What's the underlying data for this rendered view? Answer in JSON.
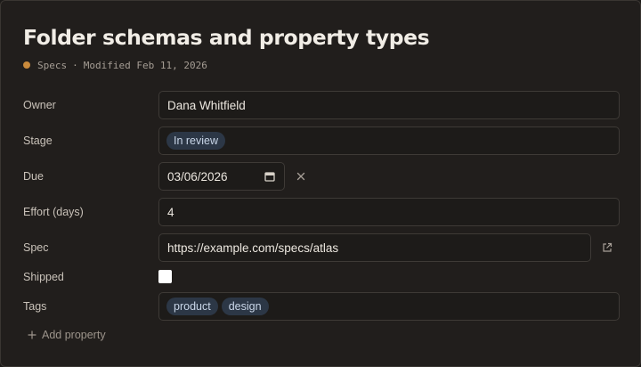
{
  "header": {
    "title": "Folder schemas and property types",
    "folder": "Specs",
    "folder_color": "#c98a3c",
    "separator": "·",
    "modified": "Modified Feb 11, 2026"
  },
  "properties": {
    "owner": {
      "label": "Owner",
      "value": "Dana Whitfield"
    },
    "stage": {
      "label": "Stage",
      "value": "In review"
    },
    "due": {
      "label": "Due",
      "value": "03/06/2026",
      "clear_icon": "close-icon",
      "picker_icon": "calendar-icon"
    },
    "effort": {
      "label": "Effort (days)",
      "value": "4"
    },
    "spec": {
      "label": "Spec",
      "value": "https://example.com/specs/atlas",
      "open_icon": "external-link-icon"
    },
    "shipped": {
      "label": "Shipped",
      "checked": false
    },
    "tags": {
      "label": "Tags",
      "values": [
        "product",
        "design"
      ]
    }
  },
  "actions": {
    "add_property": "Add property"
  },
  "colors": {
    "background": "#211e1c",
    "pill_bg": "#2c3746",
    "pill_text": "#c9d6e8"
  }
}
